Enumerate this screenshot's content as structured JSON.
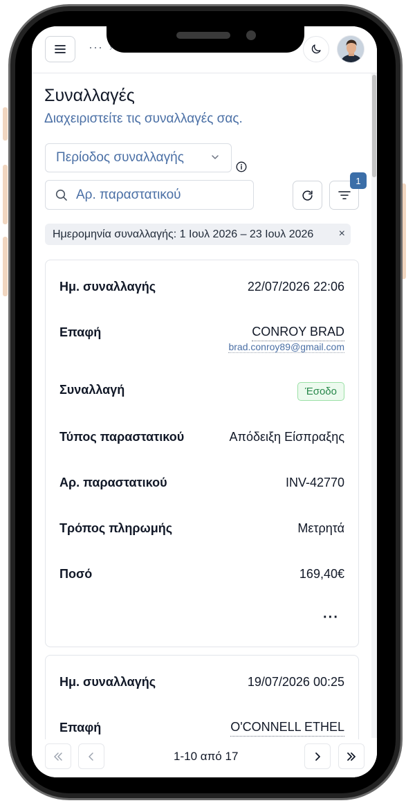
{
  "header": {
    "breadcrumb_more": "···",
    "breadcrumb_sep": "›"
  },
  "page": {
    "title": "Συναλλαγές",
    "subtitle": "Διαχειριστείτε τις συναλλαγές σας."
  },
  "filters": {
    "period_placeholder": "Περίοδος συναλλαγής",
    "search_placeholder": "Αρ. παραστατικού",
    "active_filter_count": "1",
    "active_chip": "Ημερομηνία συναλλαγής: 1 Ιουλ 2026 – 23 Ιουλ 2026",
    "chip_remove": "×"
  },
  "labels": {
    "date": "Ημ. συναλλαγής",
    "contact": "Επαφή",
    "transaction": "Συναλλαγή",
    "doc_type": "Τύπος παραστατικού",
    "doc_no": "Αρ. παραστατικού",
    "payment": "Τρόπος πληρωμής",
    "amount": "Ποσό",
    "more": "···"
  },
  "transactions": [
    {
      "date": "22/07/2026 22:06",
      "contact_name": "CONROY BRAD",
      "contact_email": "brad.conroy89@gmail.com",
      "type_badge": "Έσοδο",
      "doc_type": "Απόδειξη Είσπραξης",
      "doc_no": "INV-42770",
      "payment": "Μετρητά",
      "amount": "169,40€"
    },
    {
      "date": "19/07/2026 00:25",
      "contact_name": "O'CONNELL ETHEL"
    }
  ],
  "pagination": {
    "summary": "1-10 από 17"
  }
}
